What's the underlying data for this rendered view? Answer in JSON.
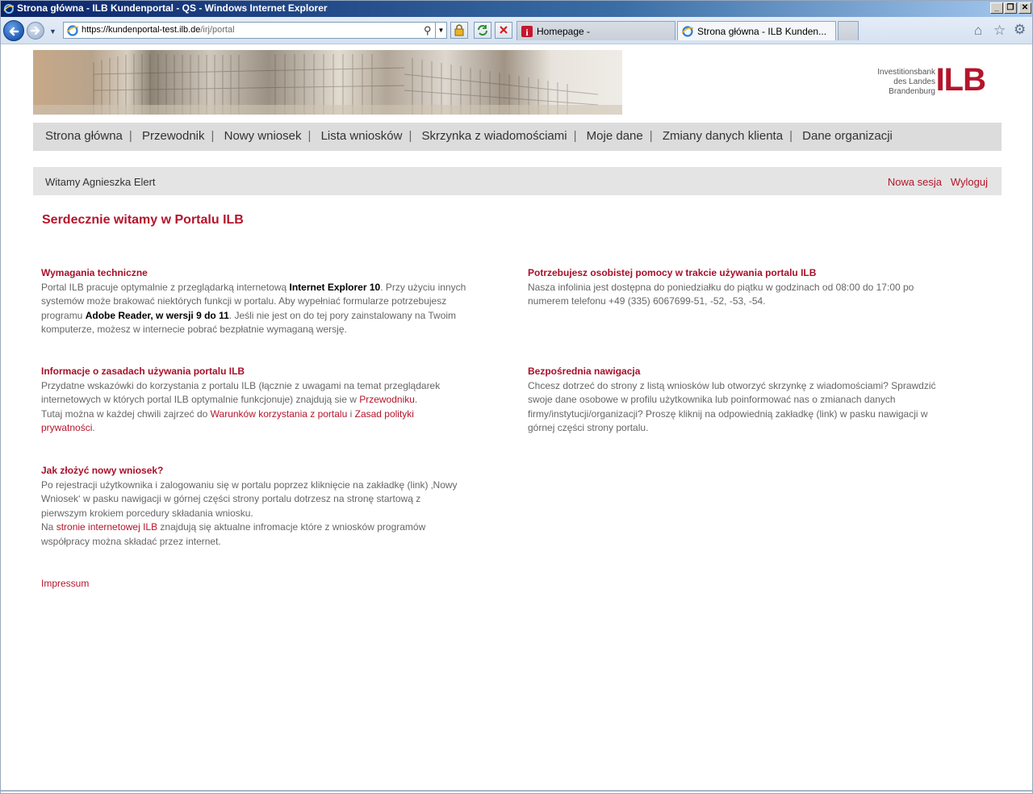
{
  "window": {
    "title": "Strona główna - ILB Kundenportal - QS - Windows Internet Explorer"
  },
  "browser": {
    "url_host": "https://kundenportal-test.ilb.de",
    "url_path": "/irj/portal",
    "tabs": [
      {
        "label": "Homepage -"
      },
      {
        "label": "Strona główna - ILB Kunden..."
      }
    ]
  },
  "logo": {
    "line1": "Investitionsbank",
    "line2": "des Landes",
    "line3": "Brandenburg",
    "mark": "ILB"
  },
  "nav": {
    "items": [
      "Strona główna",
      "Przewodnik",
      "Nowy wniosek",
      "Lista wniosków",
      "Skrzynka z wiadomościami",
      "Moje dane",
      "Zmiany danych klienta",
      "Dane organizacji"
    ],
    "separator": "|"
  },
  "welcome": {
    "greeting": "Witamy Agnieszka Elert",
    "new_session": "Nowa sesja",
    "logout": "Wyloguj"
  },
  "main": {
    "title": "Serdecznie witamy w Portalu ILB",
    "tech": {
      "heading": "Wymagania techniczne",
      "t1": "Portal ILB pracuje optymalnie z przeglądarką internetową ",
      "b1": "Internet Explorer 10",
      "t2": ". Przy użyciu innych systemów może brakować niektórych funkcji w portalu. Aby wypełniać formularze potrzebujesz programu ",
      "b2": "Adobe Reader, w wersji 9 do 11",
      "t3": ". Jeśli nie jest on do tej pory zainstalowany na Twoim komputerze, możesz w internecie pobrać bezpłatnie wymaganą wersję."
    },
    "help": {
      "heading": "Potrzebujesz osobistej pomocy w trakcie używania portalu ILB",
      "text": "Nasza infolinia jest dostępna do poniedziałku do piątku w godzinach od 08:00 do 17:00 po numerem telefonu +49 (335) 6067699-51, -52, -53, -54."
    },
    "rules": {
      "heading": "Informacje o zasadach używania portalu ILB",
      "t1": "Przydatne wskazówki do korzystania z portalu ILB (łącznie z uwagami na temat przeglądarek internetowych w których portal ILB optymalnie funkcjonuje) znajdują sie w ",
      "link1": "Przewodniku",
      "t2": ".",
      "t3": "Tutaj można w każdej chwili zajrzeć do ",
      "link2": "Warunków korzystania z portalu",
      "t4": " i ",
      "link3": "Zasad polityki prywatności",
      "t5": "."
    },
    "direct": {
      "heading": "Bezpośrednia nawigacja",
      "text": "Chcesz dotrzeć do strony z listą wniosków lub otworzyć skrzynkę z wiadomościami? Sprawdzić swoje dane osobowe w profilu użytkownika lub poinformować nas o zmianach danych firmy/instytucji/organizacji? Proszę kliknij na odpowiednią zakładkę (link) w pasku nawigacji w górnej części strony portalu."
    },
    "newapp": {
      "heading": "Jak złożyć nowy wniosek?",
      "t1": "Po rejestracji użytkownika i zalogowaniu się w portalu poprzez kliknięcie na zakładkę (link) ‚Nowy Wniosek‘ w pasku nawigacji w górnej części strony portalu dotrzesz na stronę startową z pierwszym krokiem porcedury składania wniosku.",
      "t2": "Na ",
      "link": "stronie internetowej ILB",
      "t3": " znajdują się aktualne infromacje które z wniosków programów współpracy można składać przez internet."
    },
    "impressum": "Impressum"
  }
}
